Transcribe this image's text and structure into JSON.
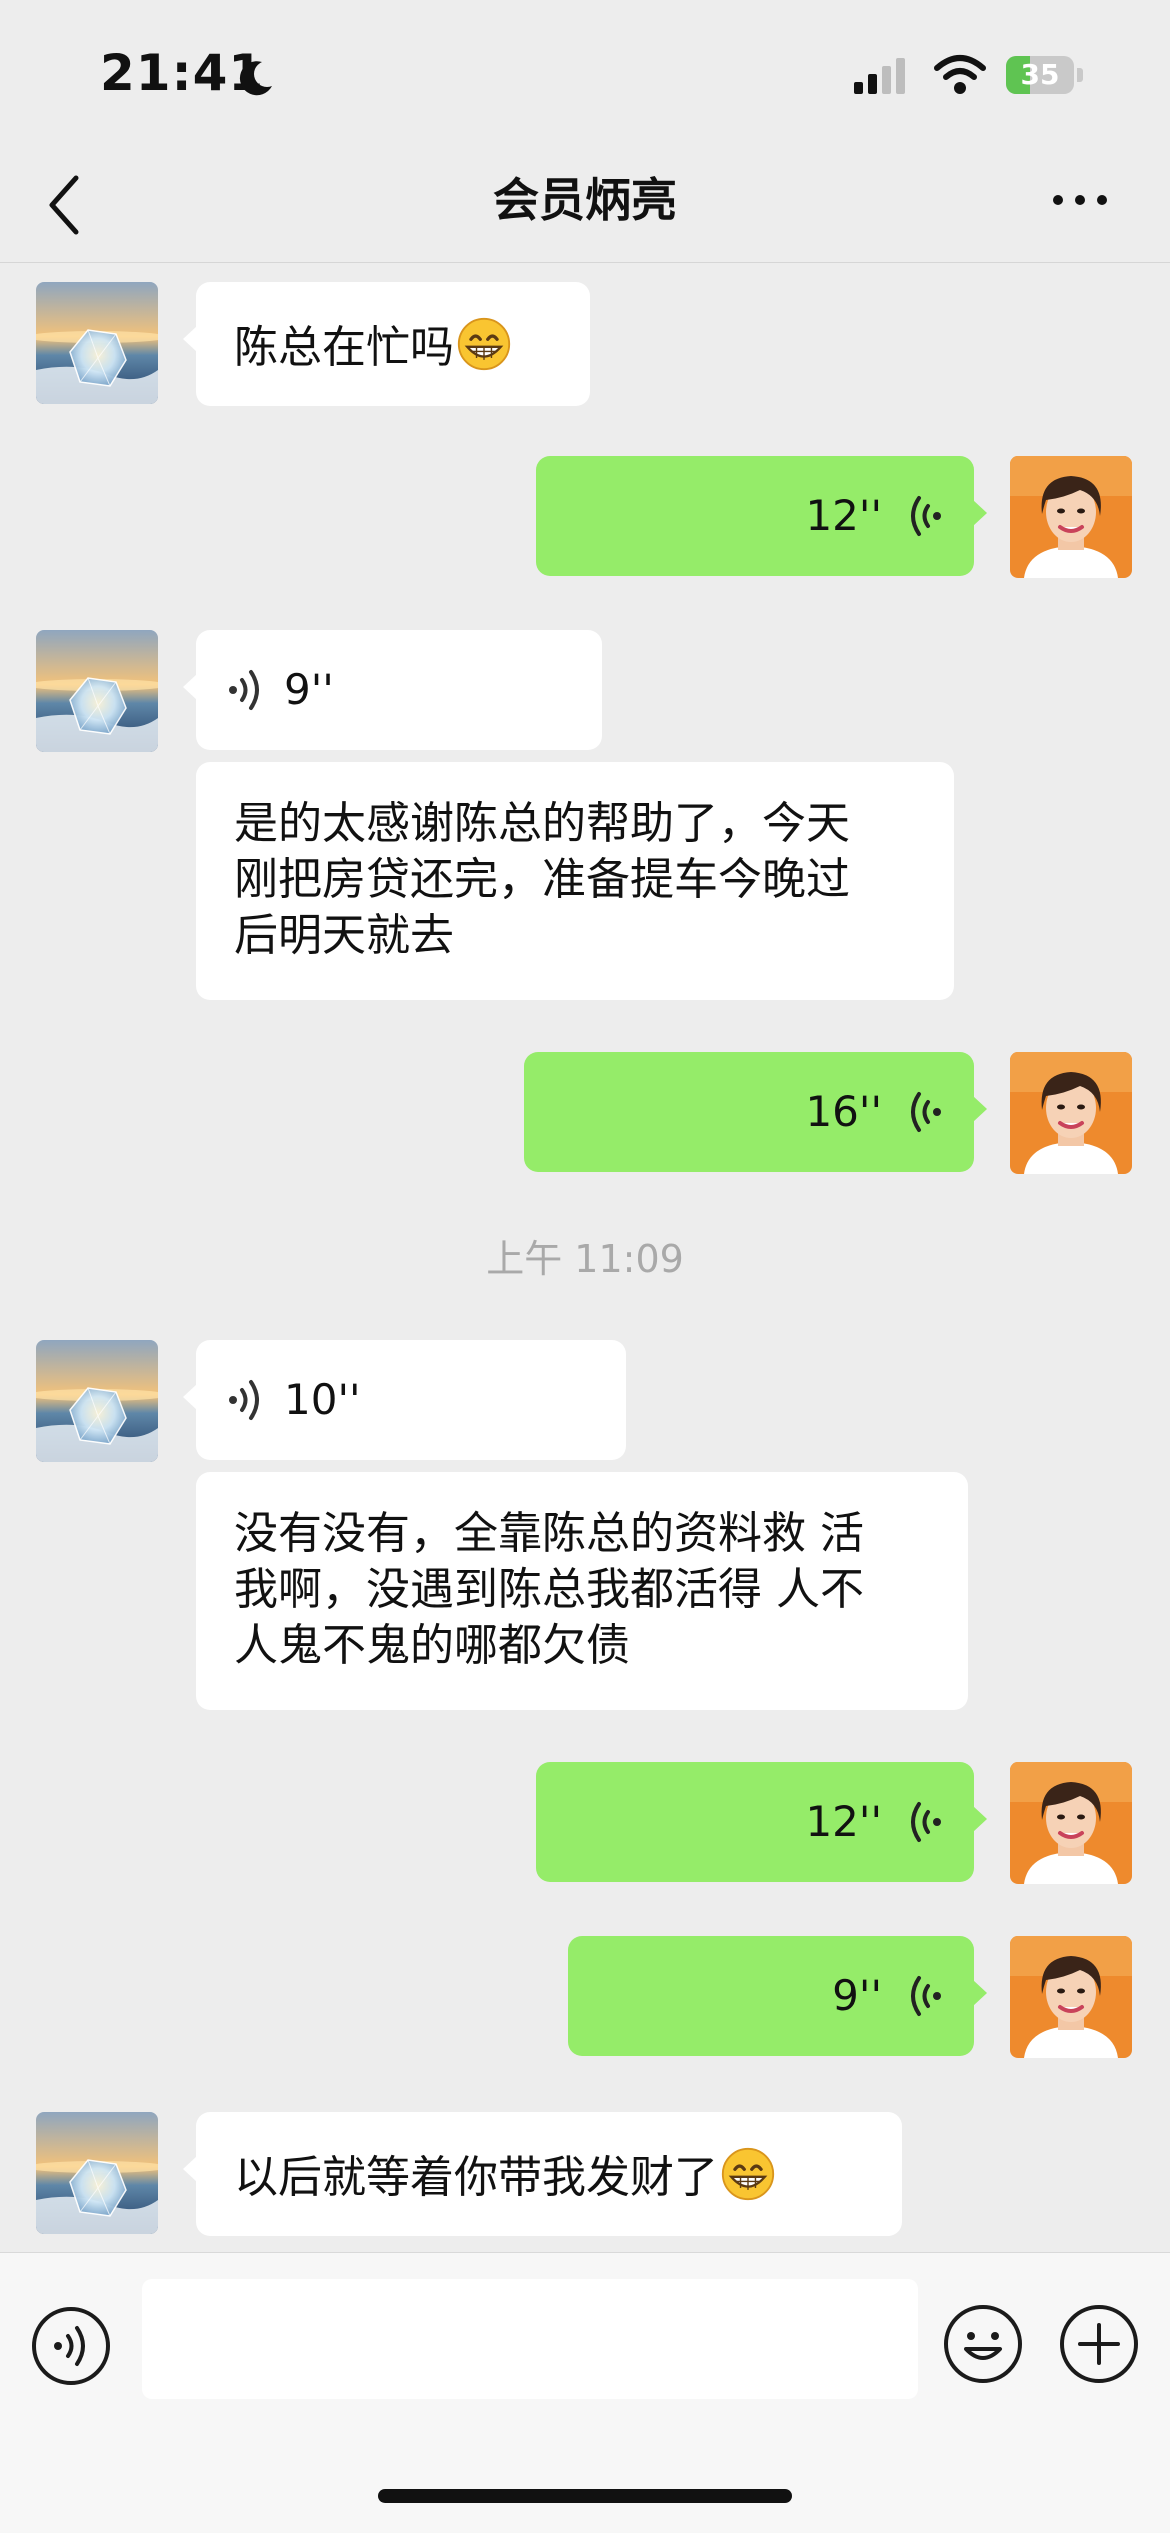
{
  "status_bar": {
    "time": "21:41",
    "battery_level": "35",
    "battery_fraction": 0.35,
    "icons": [
      "moon-icon",
      "cellular-signal-icon",
      "wifi-icon",
      "battery-charging-icon"
    ]
  },
  "header": {
    "title": "会员炳亮",
    "back_icon": "chevron-left-icon",
    "more_icon": "more-dots-icon"
  },
  "messages": [
    {
      "from": "contact",
      "type": "text",
      "text": "陈总在忙吗",
      "emoji": "grinning-face-emoji"
    },
    {
      "from": "me",
      "type": "voice",
      "duration": "12''"
    },
    {
      "from": "contact",
      "type": "voice",
      "duration": "9''"
    },
    {
      "from": "contact",
      "type": "text",
      "lines": [
        "是的太感谢陈总的帮助了，今天",
        "刚把房贷还完，准备提车今晚过",
        "后明天就去"
      ]
    },
    {
      "from": "me",
      "type": "voice",
      "duration": "16''"
    },
    {
      "type": "timestamp",
      "text": "上午 11:09"
    },
    {
      "from": "contact",
      "type": "voice",
      "duration": "10''"
    },
    {
      "from": "contact",
      "type": "text",
      "lines": [
        "没有没有，全靠陈总的资料救 活",
        "我啊，没遇到陈总我都活得 人不",
        "人鬼不鬼的哪都欠债"
      ]
    },
    {
      "from": "me",
      "type": "voice",
      "duration": "12''"
    },
    {
      "from": "me",
      "type": "voice",
      "duration": "9''"
    },
    {
      "from": "contact",
      "type": "text",
      "text": "以后就等着你带我发财了",
      "emoji": "grinning-face-emoji"
    }
  ],
  "input_bar": {
    "voice_toggle_icon": "voice-mode-icon",
    "text_value": "",
    "emoji_icon": "emoji-face-icon",
    "plus_icon": "plus-circle-icon"
  },
  "colors": {
    "background": "#ededed",
    "outgoing_bubble": "#95ec69",
    "incoming_bubble": "#ffffff",
    "timestamp": "#a9a9a9",
    "battery": "#5fc452"
  }
}
